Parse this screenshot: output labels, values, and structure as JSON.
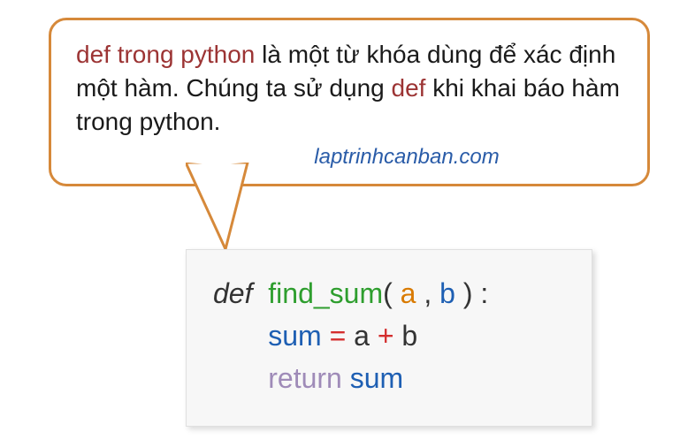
{
  "bubble": {
    "text_part1": "def trong python",
    "text_part2": " là một từ khóa dùng để xác định một hàm. Chúng ta sử dụng ",
    "text_part3": "def",
    "text_part4": " khi khai báo hàm trong python.",
    "attribution": "laptrinhcanban.com"
  },
  "code": {
    "line1": {
      "def": "def ",
      "space": " ",
      "fn": "find_sum",
      "open": "(",
      "sp1": " ",
      "a": "a",
      "sp2": " ",
      "comma": ",",
      "sp3": " ",
      "b": "b",
      "sp4": " ",
      "close": ")",
      "sp5": " ",
      "colon": ":"
    },
    "line2": {
      "indent": "       ",
      "sum": "sum",
      "sp1": " ",
      "eq": "=",
      "sp2": " ",
      "a": "a",
      "sp3": " ",
      "plus": "+",
      "sp4": " ",
      "b": "b"
    },
    "line3": {
      "indent": "       ",
      "return": "return",
      "sp": " ",
      "sum": "sum"
    }
  },
  "colors": {
    "bubble_border": "#d6893a",
    "keyword_highlight": "#9c3434",
    "attribution": "#2a5ca8",
    "fn_green": "#2e9e2e",
    "param_orange": "#d97a00",
    "param_blue": "#1e5fb3",
    "op_red": "#d42e2e",
    "return_purple": "#9f8bb8"
  }
}
